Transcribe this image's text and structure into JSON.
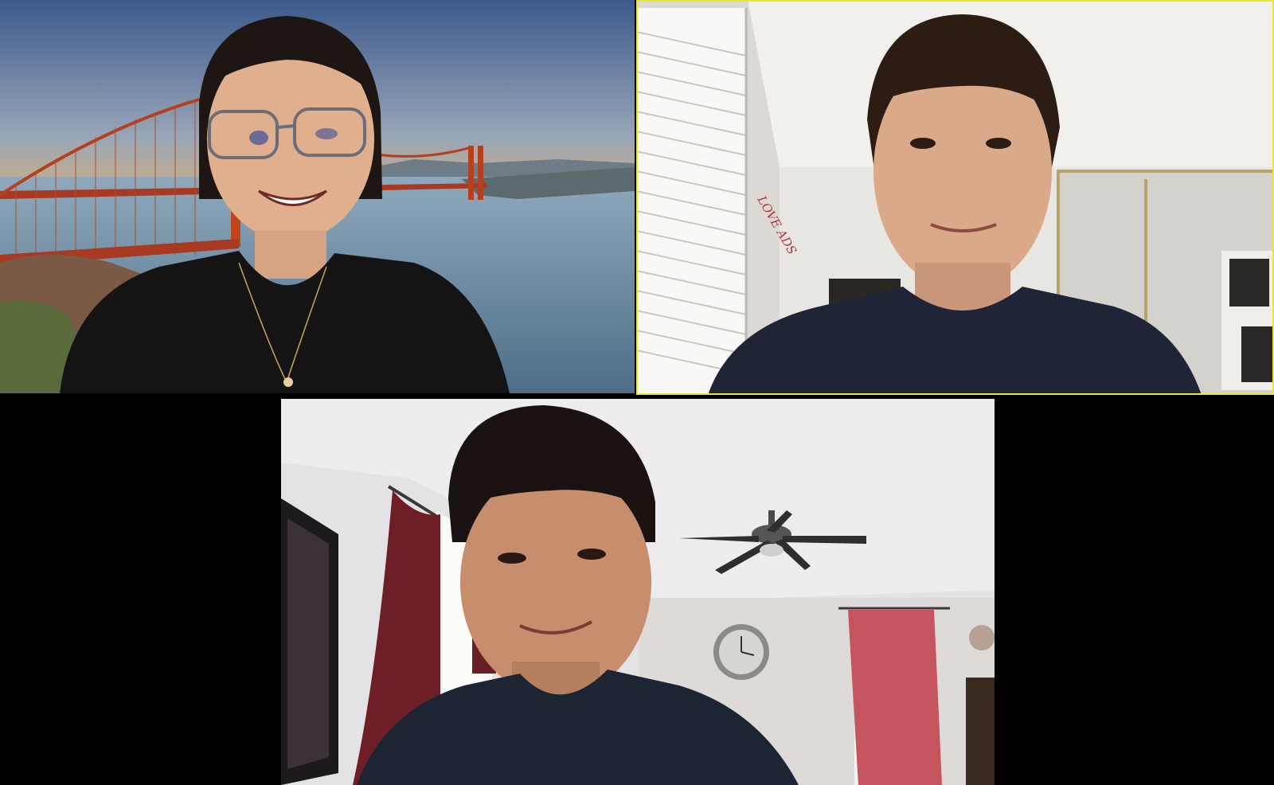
{
  "meeting": {
    "layout": "gallery-view",
    "active_speaker_color": "#e6e832"
  },
  "participants": [
    {
      "tile_id": "tile-1",
      "active_speaker": false,
      "background": "virtual-golden-gate-bridge",
      "icon": "participant-video"
    },
    {
      "tile_id": "tile-2",
      "active_speaker": true,
      "background": "bedroom",
      "icon": "participant-video",
      "wall_sign_text": "LOVE ADS"
    },
    {
      "tile_id": "tile-3",
      "active_speaker": false,
      "background": "living-room",
      "icon": "participant-video"
    }
  ]
}
